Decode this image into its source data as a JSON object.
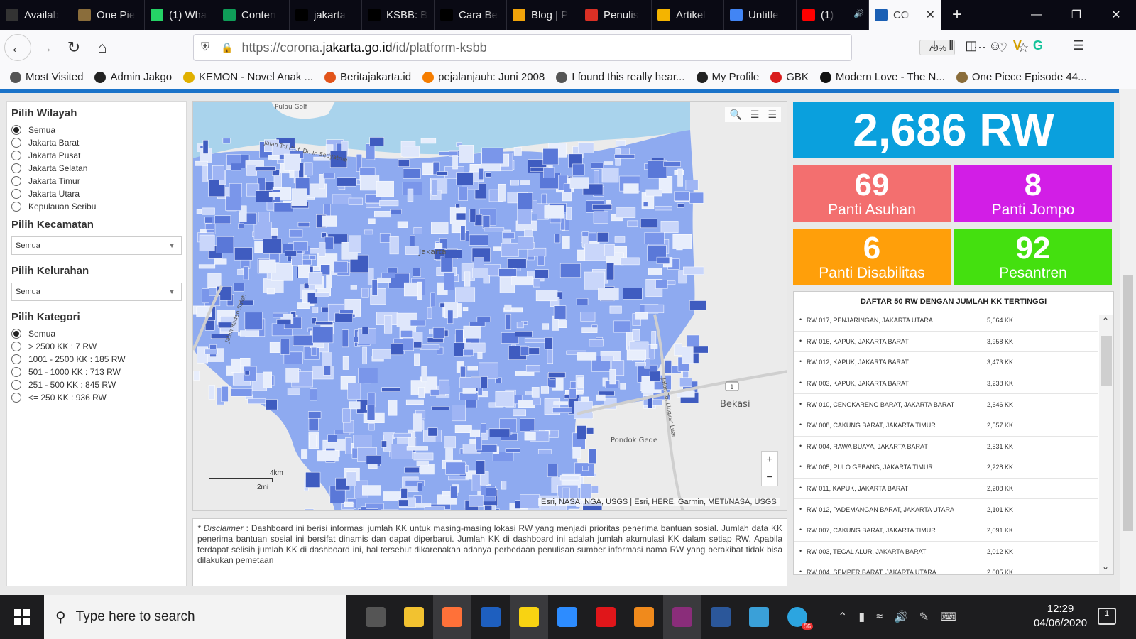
{
  "browser": {
    "tabs": [
      {
        "title": "Availab",
        "icon": "github-icon",
        "color": "#333333"
      },
      {
        "title": "One Pie",
        "icon": "onepiece-icon",
        "color": "#8a6d3b"
      },
      {
        "title": "(1) Wha",
        "icon": "whatsapp-icon",
        "color": "#25d366"
      },
      {
        "title": "Conten",
        "icon": "sheets-icon",
        "color": "#0f9d58"
      },
      {
        "title": "jakarta",
        "icon": "medium-icon",
        "color": "#000000"
      },
      {
        "title": "KSBB: B",
        "icon": "medium-icon",
        "color": "#000000"
      },
      {
        "title": "Cara Be",
        "icon": "medium-icon",
        "color": "#000000"
      },
      {
        "title": "Blog | P",
        "icon": "bulb-icon",
        "color": "#f0a30a"
      },
      {
        "title": "Penulis",
        "icon": "gmail-icon",
        "color": "#d93025"
      },
      {
        "title": "Artikel",
        "icon": "drive-icon",
        "color": "#f4b400"
      },
      {
        "title": "Untitle",
        "icon": "docs-icon",
        "color": "#4285f4"
      },
      {
        "title": "(1)",
        "icon": "youtube-icon",
        "color": "#ff0000"
      },
      {
        "title": "CO",
        "icon": "jakarta-icon",
        "color": "#1a5fb4"
      }
    ],
    "url_prefix": "https://corona.",
    "url_domain": "jakarta.go.id",
    "url_path": "/id/platform-ksbb",
    "zoom": "70%",
    "bookmarks": [
      {
        "label": "Most Visited",
        "icon": "gear-icon",
        "color": "#555555"
      },
      {
        "label": "Admin Jakgo",
        "icon": "jakgo-icon",
        "color": "#222222"
      },
      {
        "label": "KEMON - Novel Anak ...",
        "icon": "kemon-icon",
        "color": "#e0b000"
      },
      {
        "label": "Beritajakarta.id",
        "icon": "berita-icon",
        "color": "#e2541b"
      },
      {
        "label": "pejalanjauh: Juni 2008",
        "icon": "blogger-icon",
        "color": "#f57d00"
      },
      {
        "label": "I found this really hear...",
        "icon": "globe-icon",
        "color": "#555555"
      },
      {
        "label": "My Profile",
        "icon": "star-icon",
        "color": "#222222"
      },
      {
        "label": "GBK",
        "icon": "gbk-icon",
        "color": "#d91c1c"
      },
      {
        "label": "Modern Love - The N...",
        "icon": "nyt-icon",
        "color": "#111111"
      },
      {
        "label": "One Piece Episode 44...",
        "icon": "onepiece-icon",
        "color": "#8a6d3b"
      }
    ]
  },
  "filters": {
    "wilayah_title": "Pilih Wilayah",
    "wilayah": [
      "Semua",
      "Jakarta Barat",
      "Jakarta Pusat",
      "Jakarta Selatan",
      "Jakarta Timur",
      "Jakarta Utara",
      "Kepulauan Seribu"
    ],
    "kecamatan_title": "Pilih Kecamatan",
    "kecamatan_value": "Semua",
    "kelurahan_title": "Pilih Kelurahan",
    "kelurahan_value": "Semua",
    "kategori_title": "Pilih Kategori",
    "kategori": [
      "Semua",
      "> 2500 KK : 7 RW",
      "1001 - 2500 KK : 185 RW",
      "501 - 1000 KK : 713 RW",
      "251 - 500 KK : 845 RW",
      "<= 250 KK : 936 RW"
    ]
  },
  "map": {
    "labels": {
      "pulau_golf": "Pulau Golf",
      "jakarta": "Jakarta",
      "bekasi": "Bekasi",
      "pondok_gede": "Pondok Gede",
      "sedyatmo": "Jalan Tol Prof. Dr. Ir. Sedyatmo",
      "raden_saleh": "Jalan Raden Saleh",
      "lingkar_luar": "Jalan Tol Lingkar Luar",
      "route": "1"
    },
    "scale_km": "4km",
    "scale_mi": "2mi",
    "attribution": "Esri, NASA, NGA, USGS | Esri, HERE, Garmin, METI/NASA, USGS",
    "zoom_in": "+",
    "zoom_out": "−"
  },
  "disclaimer": {
    "label": "* Disclaimer",
    "text": " : Dashboard ini berisi informasi jumlah KK untuk masing-masing lokasi RW  yang menjadi prioritas penerima bantuan sosial. Jumlah data KK penerima bantuan sosial ini bersifat dinamis dan dapat diperbarui. Jumlah KK di dashboard ini adalah jumlah akumulasi KK dalam setiap RW. Apabila terdapat selisih jumlah KK di dashboard ini, hal tersebut dikarenakan adanya perbedaan penulisan sumber informasi nama RW yang berakibat tidak bisa dilakukan pemetaan"
  },
  "stats": {
    "total": "2,686 RW",
    "cards": [
      {
        "num": "69",
        "label": "Panti Asuhan",
        "color": "#f36f6f"
      },
      {
        "num": "8",
        "label": "Panti Jompo",
        "color": "#d21ee6"
      },
      {
        "num": "6",
        "label": "Panti Disabilitas",
        "color": "#ff9f0a"
      },
      {
        "num": "92",
        "label": "Pesantren",
        "color": "#44e00f"
      }
    ]
  },
  "list": {
    "title": "DAFTAR 50 RW DENGAN JUMLAH KK TERTINGGI",
    "rows": [
      {
        "name": "RW 017, PENJARINGAN, JAKARTA UTARA",
        "value": "5,664 KK"
      },
      {
        "name": "RW 016, KAPUK, JAKARTA BARAT",
        "value": "3,958 KK"
      },
      {
        "name": "RW 012, KAPUK, JAKARTA BARAT",
        "value": "3,473 KK"
      },
      {
        "name": "RW 003, KAPUK, JAKARTA BARAT",
        "value": "3,238 KK"
      },
      {
        "name": "RW 010, CENGKARENG BARAT, JAKARTA BARAT",
        "value": "2,646 KK"
      },
      {
        "name": "RW 008, CAKUNG BARAT, JAKARTA TIMUR",
        "value": "2,557 KK"
      },
      {
        "name": "RW 004, RAWA BUAYA, JAKARTA BARAT",
        "value": "2,531 KK"
      },
      {
        "name": "RW 005, PULO GEBANG, JAKARTA TIMUR",
        "value": "2,228 KK"
      },
      {
        "name": "RW 011, KAPUK, JAKARTA BARAT",
        "value": "2,208 KK"
      },
      {
        "name": "RW 012, PADEMANGAN BARAT, JAKARTA UTARA",
        "value": "2,101 KK"
      },
      {
        "name": "RW 007, CAKUNG BARAT, JAKARTA TIMUR",
        "value": "2,091 KK"
      },
      {
        "name": "RW 003, TEGAL ALUR, JAKARTA BARAT",
        "value": "2,012 KK"
      },
      {
        "name": "RW 004, SEMPER BARAT, JAKARTA UTARA",
        "value": "2,005 KK"
      }
    ]
  },
  "taskbar": {
    "search_placeholder": "Type here to search",
    "time": "12:29",
    "date": "04/06/2020",
    "notifications": "1",
    "telegram_badge": "56",
    "apps": [
      {
        "name": "task-view-icon",
        "color": "#555555",
        "active": false
      },
      {
        "name": "file-explorer-icon",
        "color": "#f2c230",
        "active": false
      },
      {
        "name": "firefox-icon",
        "color": "#ff7139",
        "active": true
      },
      {
        "name": "photos-icon",
        "color": "#1e5fbf",
        "active": false
      },
      {
        "name": "sticky-notes-icon",
        "color": "#f8d312",
        "active": true
      },
      {
        "name": "zoom-icon",
        "color": "#2d8cff",
        "active": false
      },
      {
        "name": "opera-icon",
        "color": "#e0161a",
        "active": false
      },
      {
        "name": "pdf-icon",
        "color": "#f08a1c",
        "active": false
      },
      {
        "name": "winrar-icon",
        "color": "#8a2d7a",
        "active": true
      },
      {
        "name": "word-icon",
        "color": "#2b579a",
        "active": false
      },
      {
        "name": "gallery-icon",
        "color": "#3aa0d8",
        "active": false
      },
      {
        "name": "telegram-icon",
        "color": "#2ca5e0",
        "active": false
      }
    ]
  }
}
